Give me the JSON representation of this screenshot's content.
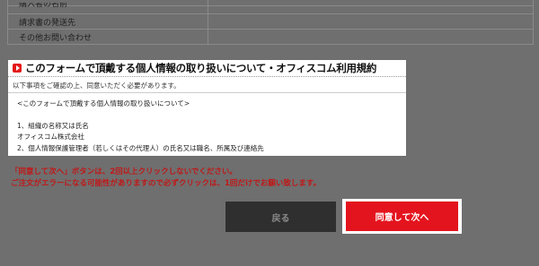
{
  "table": {
    "rows": [
      {
        "label": "購入者の名前"
      },
      {
        "label": "請求書の発送先"
      },
      {
        "label": "その他お問い合わせ"
      }
    ]
  },
  "panel": {
    "title": "このフォームで頂戴する個人情報の取り扱いについて・オフィスコム利用規約",
    "subtitle": "以下事項をご確認の上、同意いただく必要があります。",
    "policy_lines": [
      "<このフォームで頂戴する個人情報の取り扱いについて>",
      "1、組織の名称又は氏名",
      "オフィスコム株式会社",
      "2、個人情報保護管理者（若しくはその代理人）の氏名又は職名、所属及び連絡先"
    ]
  },
  "warning": {
    "line1": "「同意して次へ」ボタンは、2回以上クリックしないでください。",
    "line2": "ご注文がエラーになる可能性がありますので必ずクリックは、1回だけでお願い致します。"
  },
  "buttons": {
    "back_label": "戻る",
    "agree_label": "同意して次へ"
  },
  "colors": {
    "accent": "#e4141e",
    "warning": "#c01818",
    "overlay": "#6f6f6f"
  }
}
